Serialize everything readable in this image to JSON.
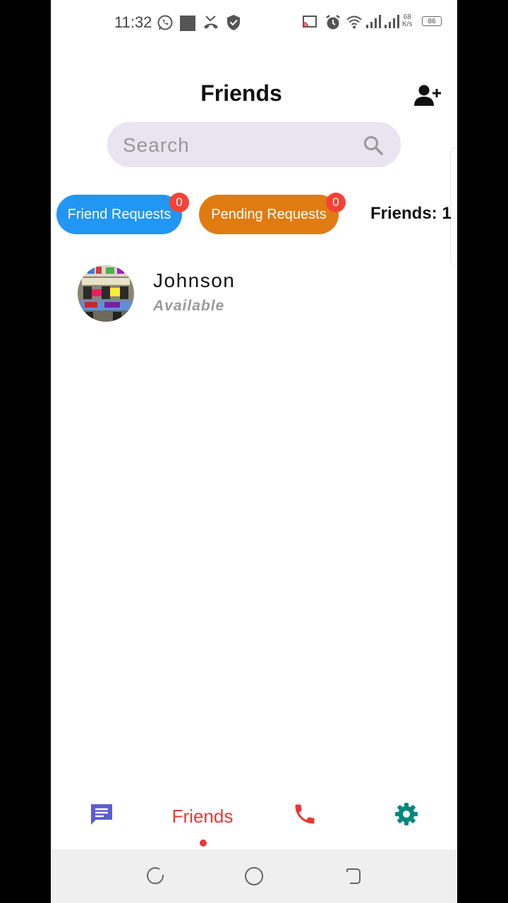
{
  "status_bar": {
    "time": "11:32",
    "network_speed_value": "68",
    "network_speed_unit": "K/s",
    "battery": "86"
  },
  "header": {
    "title": "Friends",
    "add_friend_icon": "person-add-icon"
  },
  "search": {
    "placeholder": "Search",
    "value": "",
    "icon": "search-icon"
  },
  "chips": {
    "friend_requests": {
      "label": "Friend Requests",
      "badge": "0",
      "color": "#2196f3"
    },
    "pending_requests": {
      "label": "Pending Requests",
      "badge": "0",
      "color": "#e07b12"
    },
    "friends_count_label": "Friends: 1"
  },
  "friends": [
    {
      "name": "Johnson",
      "status": "Available",
      "avatar": "graffiti-building-photo"
    }
  ],
  "bottom_nav": {
    "items": [
      {
        "icon": "chat-icon",
        "color": "#5b5bd6"
      },
      {
        "label": "Friends",
        "active": true,
        "color": "#e53935"
      },
      {
        "icon": "phone-icon",
        "color": "#e53935"
      },
      {
        "icon": "gear-icon",
        "color": "#00897b"
      }
    ]
  },
  "system_nav": [
    "recents-icon",
    "home-icon",
    "back-icon"
  ]
}
